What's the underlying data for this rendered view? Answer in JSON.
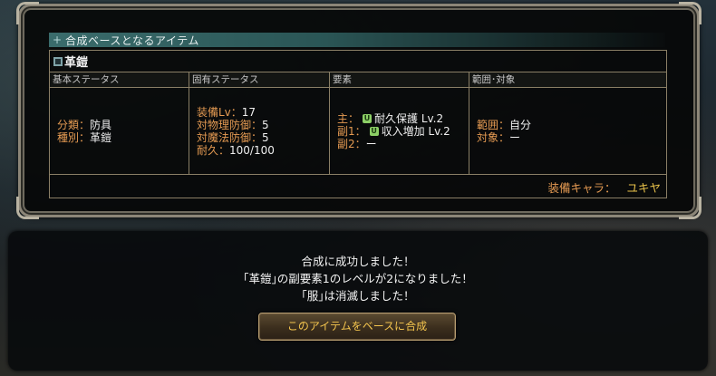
{
  "section": {
    "title": "合成ベースとなるアイテム"
  },
  "item": {
    "name": "革鎧",
    "columns": {
      "basic_header": "基本ステータス",
      "unique_header": "固有ステータス",
      "element_header": "要素",
      "range_header": "範囲･対象"
    },
    "basic": [
      {
        "label": "分類：",
        "value": "防具"
      },
      {
        "label": "種別：",
        "value": "革鎧"
      }
    ],
    "unique": [
      {
        "label": "装備Lv：",
        "value": "17"
      },
      {
        "label": "対物理防御：",
        "value": "5"
      },
      {
        "label": "対魔法防御：",
        "value": "5"
      },
      {
        "label": "耐久：",
        "value": "100/100"
      }
    ],
    "elements": [
      {
        "label": "主：",
        "icon": "U",
        "value": "耐久保護 Lv.2"
      },
      {
        "label": "副1：",
        "icon": "U",
        "value": "収入増加 Lv.2"
      },
      {
        "label": "副2：",
        "value": "ー"
      }
    ],
    "range": [
      {
        "label": "範囲：",
        "value": "自分"
      },
      {
        "label": "対象：",
        "value": "ー"
      }
    ],
    "equip_label": "装備キャラ：",
    "equip_chara": "ユキヤ"
  },
  "dialog": {
    "line1": "合成に成功しました！",
    "line2": "｢革鎧｣の副要素1のレベルが2になりました！",
    "line3": "｢服｣は消滅しました！",
    "button_label": "このアイテムをベースに合成"
  },
  "colors": {
    "label_orange": "#e49a52",
    "chara_yellow": "#e9c24a",
    "header_teal": "#3a6c6c",
    "button_text": "#f3c44e"
  }
}
